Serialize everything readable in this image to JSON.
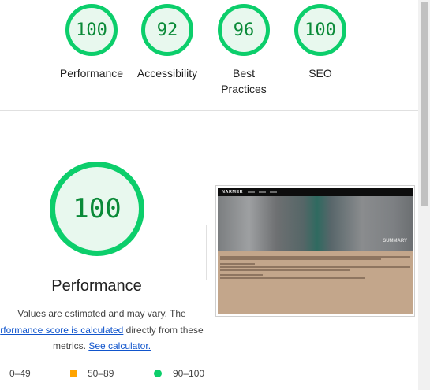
{
  "category_gauges": [
    {
      "score": "100",
      "label": "Performance"
    },
    {
      "score": "92",
      "label": "Accessibility"
    },
    {
      "score": "96",
      "label": "Best Practices"
    },
    {
      "score": "100",
      "label": "SEO"
    }
  ],
  "performance": {
    "score": "100",
    "title": "Performance",
    "description": {
      "line1": "Values are estimated and may vary. The",
      "link1": "rformance score is calculated",
      "line2_suffix": " directly from these",
      "line3_prefix": "metrics. ",
      "link2": "See calculator."
    }
  },
  "legend": {
    "fail": "0–49",
    "average": "50–89",
    "pass": "90–100"
  },
  "screenshot": {
    "logo": "NARMER",
    "overlay_text": "SUMMARY"
  },
  "colors": {
    "pass_green": "#0cce6b",
    "pass_text": "#0a8a38",
    "average_orange": "#ffa400",
    "link_blue": "#1155cc"
  }
}
